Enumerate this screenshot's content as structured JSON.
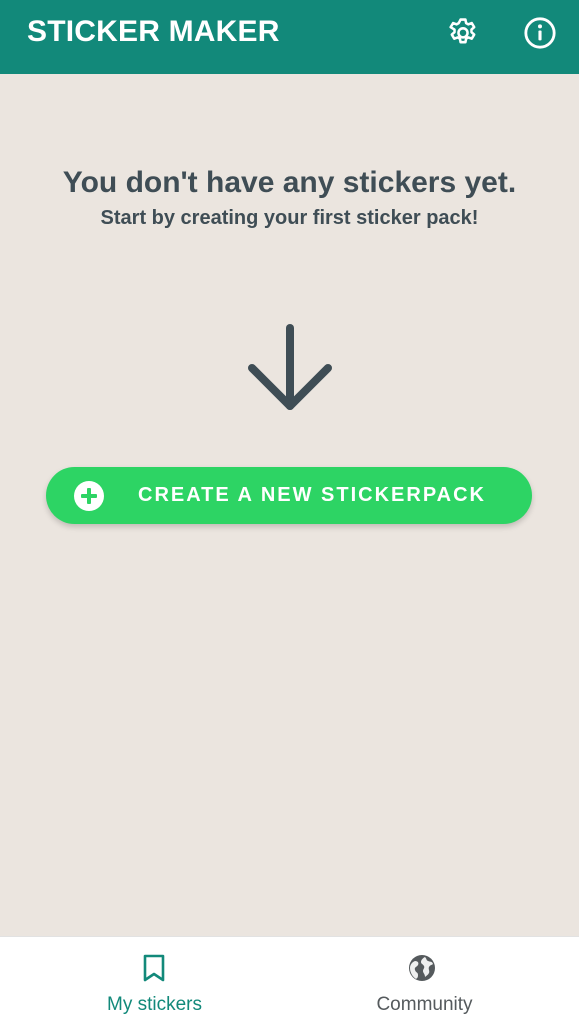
{
  "appbar": {
    "title": "STICKER MAKER",
    "actions": [
      {
        "icon": "gear-icon",
        "name": "settings"
      },
      {
        "icon": "info-icon",
        "name": "info"
      }
    ],
    "background": "#12897a"
  },
  "empty_state": {
    "title": "You don't have any stickers yet.",
    "subtitle": "Start by creating your first sticker pack!",
    "arrow_icon": "arrow-down-icon"
  },
  "create_button": {
    "label": "CREATE A NEW STICKERPACK",
    "icon": "plus-circle-icon",
    "color": "#2dd464"
  },
  "bottom_nav": {
    "items": [
      {
        "label": "My stickers",
        "icon": "bookmark-icon",
        "active": true
      },
      {
        "label": "Community",
        "icon": "globe-icon",
        "active": false
      }
    ],
    "active_color": "#12897a"
  }
}
